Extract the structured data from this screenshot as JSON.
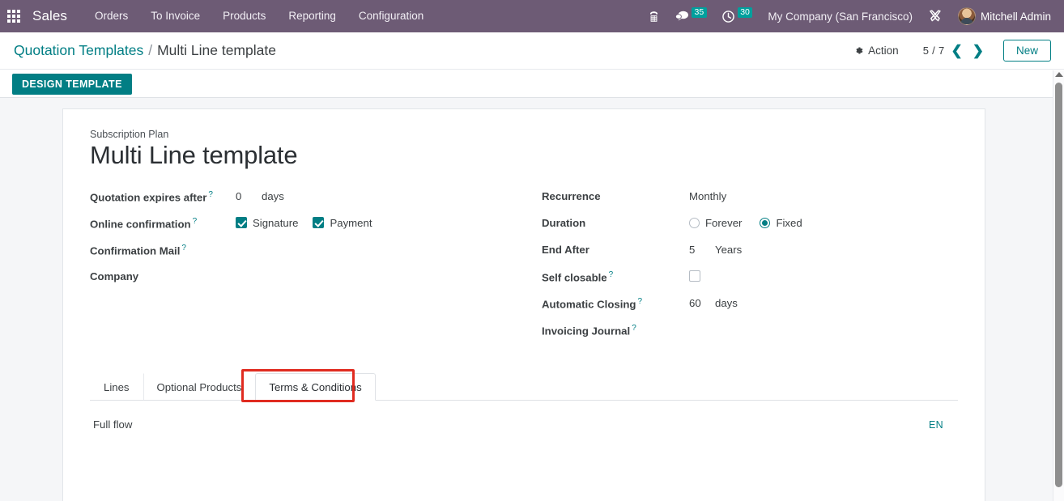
{
  "navbar": {
    "apps_icon": "grid-apps-icon",
    "brand": "Sales",
    "menu": [
      {
        "label": "Orders"
      },
      {
        "label": "To Invoice"
      },
      {
        "label": "Products"
      },
      {
        "label": "Reporting"
      },
      {
        "label": "Configuration"
      }
    ],
    "phone_icon": "telephone-icon",
    "messages_icon": "chat-bubble-icon",
    "messages_count": "35",
    "activities_icon": "clock-icon",
    "activities_count": "30",
    "company": "My Company (San Francisco)",
    "tools_icon": "tools-icon",
    "avatar": "user-avatar",
    "user": "Mitchell Admin",
    "accent_color": "#00a09d",
    "bar_color": "#6d5b75"
  },
  "breadcrumb": {
    "parent": "Quotation Templates",
    "separator": "/",
    "current": "Multi Line template"
  },
  "controls": {
    "action_icon": "gear-icon",
    "action_label": "Action",
    "pager": "5 / 7",
    "prev_icon": "chevron-left-icon",
    "next_icon": "chevron-right-icon",
    "new_label": "New"
  },
  "buttons": {
    "design_template": "DESIGN TEMPLATE"
  },
  "form": {
    "subtitle": "Subscription Plan",
    "title": "Multi Line template",
    "left_fields": [
      {
        "label": "Quotation expires after",
        "help": "?",
        "value": "0",
        "unit": "days"
      },
      {
        "label": "Online confirmation",
        "help": "?",
        "checkboxes": [
          {
            "label": "Signature",
            "checked": true
          },
          {
            "label": "Payment",
            "checked": true
          }
        ]
      },
      {
        "label": "Confirmation Mail",
        "help": "?",
        "value": ""
      },
      {
        "label": "Company",
        "help": "",
        "value": ""
      }
    ],
    "right_fields": [
      {
        "label": "Recurrence",
        "help": "",
        "value": "Monthly"
      },
      {
        "label": "Duration",
        "help": "",
        "radios": [
          {
            "label": "Forever",
            "selected": false
          },
          {
            "label": "Fixed",
            "selected": true
          }
        ]
      },
      {
        "label": "End After",
        "help": "",
        "value": "5",
        "unit": "Years"
      },
      {
        "label": "Self closable",
        "help": "?",
        "checkbox_checked": false
      },
      {
        "label": "Automatic Closing",
        "help": "?",
        "value": "60",
        "unit": "days"
      },
      {
        "label": "Invoicing Journal",
        "help": "?",
        "value": ""
      }
    ]
  },
  "notebook": {
    "tabs": [
      {
        "label": "Lines",
        "active": false
      },
      {
        "label": "Optional Products",
        "active": false
      },
      {
        "label": "Terms & Conditions",
        "active": true,
        "highlighted": true
      }
    ],
    "terms_text": "Full flow",
    "language_code": "EN",
    "highlight_color": "#e02b20"
  },
  "scrollbar": {
    "up_arrow_icon": "scroll-up-arrow-icon",
    "thumb": "scroll-thumb"
  }
}
